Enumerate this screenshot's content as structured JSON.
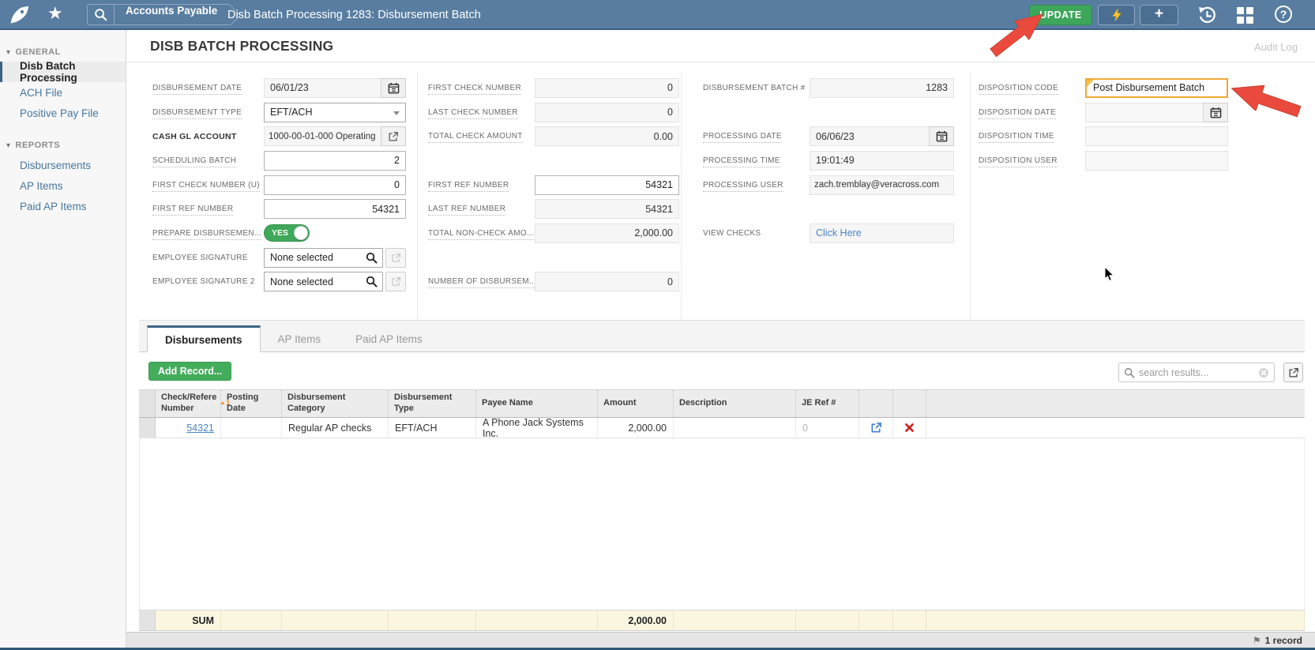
{
  "topbar": {
    "breadcrumb_app": "Accounts Payable",
    "breadcrumb_page": "Disb Batch Processing 1283: Disbursement Batch",
    "update_button": "UPDATE"
  },
  "icons": {
    "star": "★",
    "section_caret": "▾",
    "plus": "+",
    "help": "?",
    "flag": "⚑",
    "sort_asc": "▲"
  },
  "sidebar": {
    "sections": [
      {
        "title": "GENERAL",
        "items": [
          "Disb Batch Processing",
          "ACH File",
          "Positive Pay File"
        ]
      },
      {
        "title": "REPORTS",
        "items": [
          "Disbursements",
          "AP Items",
          "Paid AP Items"
        ]
      }
    ]
  },
  "page": {
    "title": "DISB BATCH PROCESSING",
    "audit_log_link": "Audit Log"
  },
  "form": {
    "disbursement_date": {
      "label": "DISBURSEMENT DATE",
      "value": "06/01/23"
    },
    "disbursement_type": {
      "label": "DISBURSEMENT TYPE",
      "value": "EFT/ACH"
    },
    "cash_gl_account": {
      "label": "CASH GL ACCOUNT",
      "value": "1000-00-01-000 Operating"
    },
    "scheduling_batch": {
      "label": "SCHEDULING BATCH",
      "value": "2"
    },
    "first_check_number_u": {
      "label": "FIRST CHECK NUMBER (U)",
      "value": "0"
    },
    "first_ref_number_1": {
      "label": "FIRST REF NUMBER",
      "value": "54321"
    },
    "prepare_disbursement": {
      "label": "PREPARE DISBURSEMEN...",
      "value": "YES"
    },
    "employee_signature": {
      "label": "EMPLOYEE SIGNATURE",
      "value": "None selected"
    },
    "employee_signature_2": {
      "label": "EMPLOYEE SIGNATURE 2",
      "value": "None selected"
    },
    "first_check_number": {
      "label": "FIRST CHECK NUMBER",
      "value": "0"
    },
    "last_check_number": {
      "label": "LAST CHECK NUMBER",
      "value": "0"
    },
    "total_check_amount": {
      "label": "TOTAL CHECK AMOUNT",
      "value": "0.00"
    },
    "first_ref_number_2": {
      "label": "FIRST REF NUMBER",
      "value": "54321"
    },
    "last_ref_number": {
      "label": "LAST REF NUMBER",
      "value": "54321"
    },
    "total_non_check_amount": {
      "label": "TOTAL NON-CHECK AMO...",
      "value": "2,000.00"
    },
    "number_of_disbursements": {
      "label": "NUMBER OF DISBURSEM...",
      "value": "0"
    },
    "disbursement_batch_number": {
      "label": "DISBURSEMENT BATCH #",
      "value": "1283"
    },
    "processing_date": {
      "label": "PROCESSING DATE",
      "value": "06/06/23"
    },
    "processing_time": {
      "label": "PROCESSING TIME",
      "value": "19:01:49"
    },
    "processing_user": {
      "label": "PROCESSING USER",
      "value": "zach.tremblay@veracross.com"
    },
    "view_checks": {
      "label": "VIEW CHECKS",
      "value": "Click Here"
    },
    "disposition_code": {
      "label": "DISPOSITION CODE",
      "value": "Post Disbursement Batch"
    },
    "disposition_date": {
      "label": "DISPOSITION DATE",
      "value": ""
    },
    "disposition_time": {
      "label": "DISPOSITION TIME",
      "value": ""
    },
    "disposition_user": {
      "label": "DISPOSITION USER",
      "value": ""
    }
  },
  "tabs": [
    {
      "label": "Disbursements",
      "active": true
    },
    {
      "label": "AP Items",
      "active": false
    },
    {
      "label": "Paid AP Items",
      "active": false
    }
  ],
  "toolbar": {
    "add_record": "Add Record...",
    "search_placeholder": "search results..."
  },
  "grid": {
    "headers": {
      "check_ref": "Check/Refere\nNumber",
      "posting_date": "Posting\nDate",
      "category": "Disbursement\nCategory",
      "type": "Disbursement Type",
      "payee": "Payee Name",
      "amount": "Amount",
      "description": "Description",
      "je_ref": "JE Ref #"
    },
    "sort_priority": "1",
    "rows": [
      {
        "check_ref": "54321",
        "posting_date": "",
        "category": "Regular AP checks",
        "type": "EFT/ACH",
        "payee": "A Phone Jack Systems Inc.",
        "amount": "2,000.00",
        "description": "",
        "je_ref": "0"
      }
    ],
    "sum_label": "SUM",
    "sum_amount": "2,000.00",
    "record_count": "1 record"
  }
}
